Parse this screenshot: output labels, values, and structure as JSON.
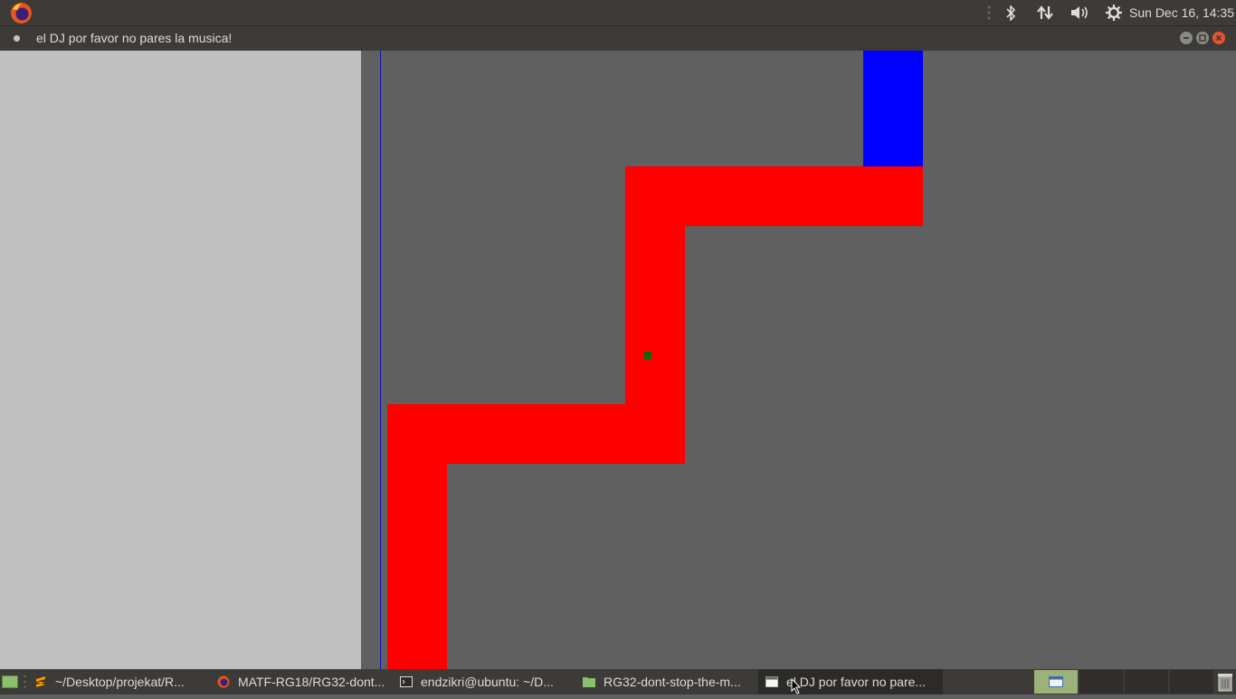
{
  "topbar": {
    "clock": "Sun Dec 16, 14:35",
    "tray_icons": [
      "menu-handle-icon",
      "bluetooth-icon",
      "network-icon",
      "volume-icon",
      "settings-gear-icon"
    ]
  },
  "window": {
    "title": "el DJ por favor no pares la musica!"
  },
  "game": {
    "colors": {
      "left_panel": "#c0c0c0",
      "background": "#606060",
      "path": "#ff0000",
      "goal": "#0000ff",
      "player": "#0a6b0a"
    }
  },
  "taskbar": {
    "tasks": [
      {
        "label": "~/Desktop/projekat/R...",
        "icon": "sublime-text-icon"
      },
      {
        "label": "MATF-RG18/RG32-dont...",
        "icon": "firefox-icon"
      },
      {
        "label": "endzikri@ubuntu: ~/D...",
        "icon": "terminal-icon"
      },
      {
        "label": "RG32-dont-stop-the-m...",
        "icon": "folder-icon"
      },
      {
        "label": "el DJ por favor no pare...",
        "icon": "window-icon"
      }
    ]
  }
}
